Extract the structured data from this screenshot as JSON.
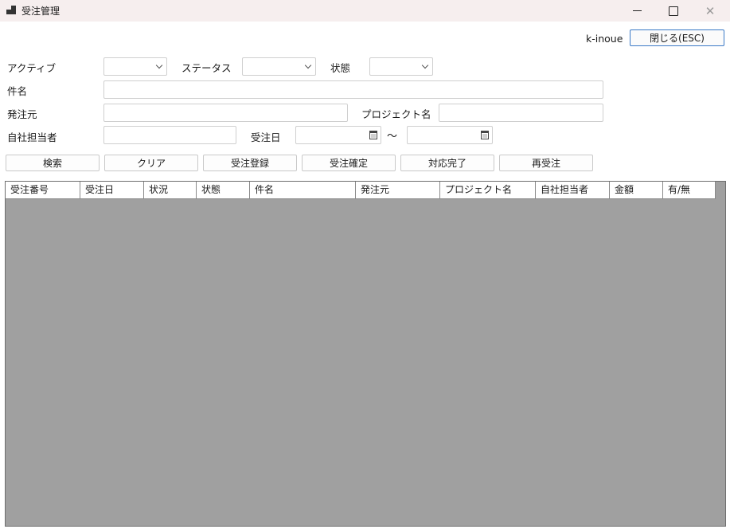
{
  "window": {
    "title": "受注管理"
  },
  "user": {
    "name": "k-inoue"
  },
  "close_button": {
    "label": "閉じる(ESC)"
  },
  "filters": {
    "active": {
      "label": "アクティブ",
      "value": ""
    },
    "status": {
      "label": "ステータス",
      "value": ""
    },
    "state": {
      "label": "状態",
      "value": ""
    },
    "subject": {
      "label": "件名",
      "value": ""
    },
    "client": {
      "label": "発注元",
      "value": ""
    },
    "project": {
      "label": "プロジェクト名",
      "value": ""
    },
    "staff": {
      "label": "自社担当者",
      "value": ""
    },
    "order_date": {
      "label": "受注日",
      "from": "",
      "to": "",
      "separator": "～"
    }
  },
  "actions": {
    "search": "検索",
    "clear": "クリア",
    "register": "受注登録",
    "confirm": "受注確定",
    "complete": "対応完了",
    "reorder": "再受注"
  },
  "grid": {
    "columns": [
      "受注番号",
      "受注日",
      "状況",
      "状態",
      "件名",
      "発注元",
      "プロジェクト名",
      "自社担当者",
      "金額",
      "有/無"
    ],
    "rows": []
  }
}
